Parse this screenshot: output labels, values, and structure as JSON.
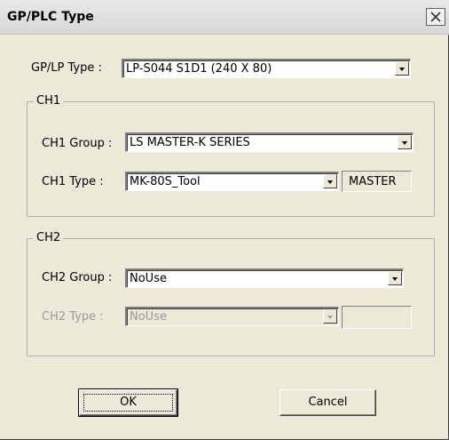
{
  "window": {
    "title": "GP/PLC Type",
    "close_icon": "close-icon"
  },
  "gplp": {
    "label": "GP/LP Type :",
    "value": "LP-S044  S1D1  (240 X 80)"
  },
  "ch1": {
    "group_title": "CH1",
    "group_label": "CH1 Group :",
    "group_value": "LS MASTER-K SERIES",
    "type_label": "CH1 Type :",
    "type_value": "MK-80S_Tool",
    "mode_value": "MASTER"
  },
  "ch2": {
    "group_title": "CH2",
    "group_label": "CH2 Group :",
    "group_value": "NoUse",
    "type_label": "CH2 Type :",
    "type_value": "NoUse",
    "mode_value": ""
  },
  "buttons": {
    "ok": "OK",
    "cancel": "Cancel"
  }
}
